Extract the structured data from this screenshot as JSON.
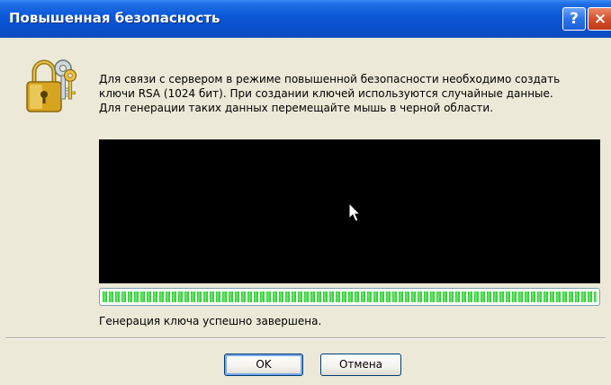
{
  "window": {
    "title": "Повышенная безопасность",
    "help_button": "?",
    "close_button": "×"
  },
  "icon": "lock-keys-icon",
  "message": {
    "line1": "Для связи с сервером в режиме повышенной безопасности необходимо создать",
    "line2": "ключи RSA (1024 бит). При создании ключей используются случайные данные.",
    "line3": "Для генерации таких данных перемещайте мышь в черной области."
  },
  "progress": {
    "value": 1.0
  },
  "status": "Генерация ключа успешно завершена.",
  "buttons": {
    "ok": "OK",
    "cancel": "Отмена"
  },
  "colors": {
    "titlebar": "#0A57D6",
    "dialog_background": "#ECE9D8",
    "mouse_area": "#000000",
    "progress_fill": "#26C231"
  }
}
